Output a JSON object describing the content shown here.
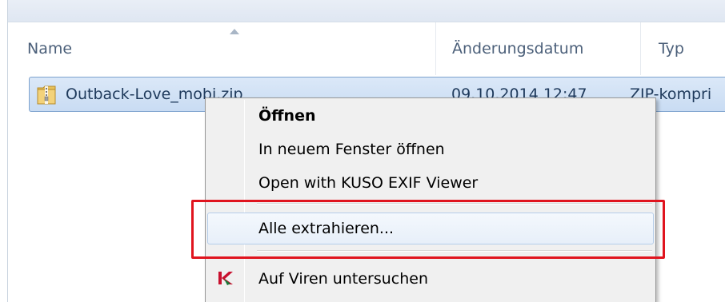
{
  "columns": {
    "name": "Name",
    "date": "Änderungsdatum",
    "type": "Typ"
  },
  "file": {
    "name": "Outback-Love_mobi.zip",
    "date": "09.10.2014 12:47",
    "type": "ZIP-kompri",
    "icon": "zip-folder-icon"
  },
  "context_menu": {
    "items": [
      {
        "label": "Öffnen",
        "bold": true
      },
      {
        "label": "In neuem Fenster öffnen"
      },
      {
        "label": "Open with KUSO EXIF Viewer"
      },
      {
        "label": "Alle extrahieren...",
        "highlighted": true
      },
      {
        "label": "Auf Viren untersuchen",
        "icon": "kaspersky-icon"
      }
    ]
  },
  "colors": {
    "highlight_border": "#e0141e",
    "selection": "#c9dcf3",
    "menu_bg": "#f0f0f0"
  }
}
